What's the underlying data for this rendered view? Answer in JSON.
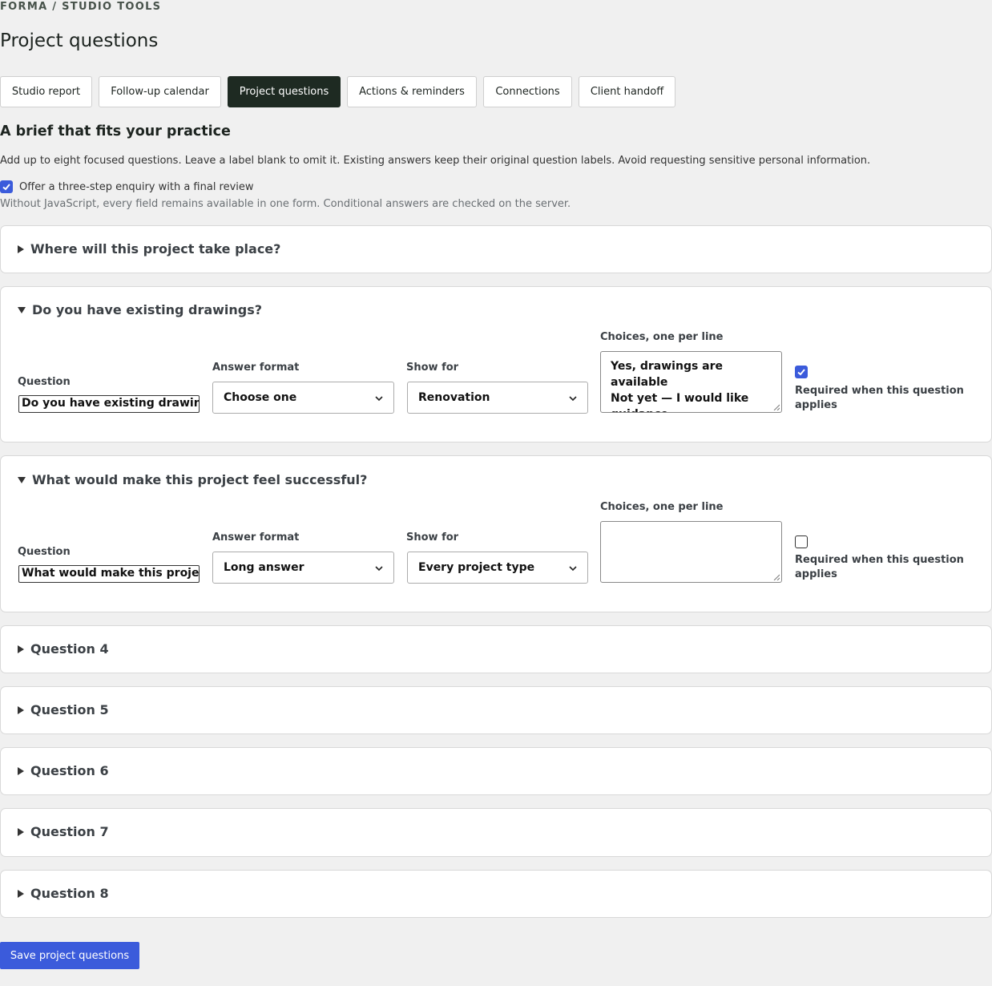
{
  "breadcrumb": "FORMA / STUDIO TOOLS",
  "page_title": "Project questions",
  "tabs": [
    {
      "label": "Studio report"
    },
    {
      "label": "Follow-up calendar"
    },
    {
      "label": "Project questions",
      "active": true
    },
    {
      "label": "Actions & reminders"
    },
    {
      "label": "Connections"
    },
    {
      "label": "Client handoff"
    }
  ],
  "section": {
    "heading": "A brief that fits your practice",
    "intro": "Add up to eight focused questions. Leave a label blank to omit it. Existing answers keep their original question labels. Avoid requesting sensitive personal information.",
    "three_step_label": "Offer a three-step enquiry with a final review",
    "three_step_checked": true,
    "hint": "Without JavaScript, every field remains available in one form. Conditional answers are checked on the server."
  },
  "field_labels": {
    "question": "Question",
    "answer_format": "Answer format",
    "show_for": "Show for",
    "choices": "Choices, one per line",
    "required": "Required when this question applies"
  },
  "questions": [
    {
      "summary": "Where will this project take place?",
      "open": false
    },
    {
      "summary": "Do you have existing drawings?",
      "open": true,
      "question": "Do you have existing drawings?",
      "answer_format": "Choose one",
      "show_for": "Renovation",
      "choices": "Yes, drawings are available\nNot yet — I would like guidance",
      "required": true
    },
    {
      "summary": "What would make this project feel successful?",
      "open": true,
      "question": "What would make this project feel successful?",
      "answer_format": "Long answer",
      "show_for": "Every project type",
      "choices": "",
      "required": false
    },
    {
      "summary": "Question 4",
      "open": false
    },
    {
      "summary": "Question 5",
      "open": false
    },
    {
      "summary": "Question 6",
      "open": false
    },
    {
      "summary": "Question 7",
      "open": false
    },
    {
      "summary": "Question 8",
      "open": false
    }
  ],
  "save_label": "Save project questions",
  "colors": {
    "accent": "#3b5bdb",
    "active_tab": "#1e2a22",
    "background": "#f0f0f0"
  }
}
